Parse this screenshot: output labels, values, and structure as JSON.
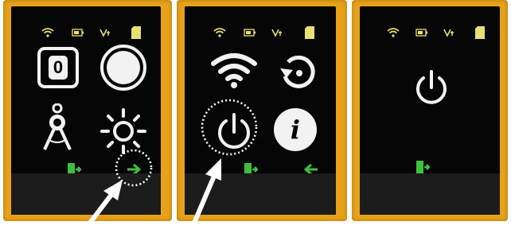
{
  "colors": {
    "housing": "#e8a21a",
    "screen": "#060606",
    "icon_white": "#f2f2f2",
    "nav_green": "#3fbf3f",
    "status_yellow": "#e8e070",
    "highlight_circle": "#ffffff"
  },
  "screens": [
    {
      "name": "main-menu",
      "status_icons": [
        "wifi-icon",
        "battery-icon",
        "bluetooth-icon",
        "sd-card-icon"
      ],
      "tiles": [
        {
          "icon": "counter-icon",
          "value": "0"
        },
        {
          "icon": "record-circle-icon"
        },
        {
          "icon": "compass-divider-icon"
        },
        {
          "icon": "brightness-icon"
        }
      ],
      "nav": [
        "exit-icon",
        "arrow-right-icon"
      ],
      "highlighted": "arrow-right-icon"
    },
    {
      "name": "settings-menu",
      "status_icons": [
        "wifi-icon",
        "battery-icon",
        "bluetooth-icon",
        "sd-card-icon"
      ],
      "tiles": [
        {
          "icon": "wifi-large-icon"
        },
        {
          "icon": "reset-icon"
        },
        {
          "icon": "power-icon"
        },
        {
          "icon": "info-icon",
          "value": "i"
        }
      ],
      "nav": [
        "exit-icon",
        "arrow-left-icon"
      ],
      "highlighted": "power-icon"
    },
    {
      "name": "power-screen",
      "status_icons": [
        "wifi-icon",
        "battery-icon",
        "bluetooth-icon",
        "sd-card-icon"
      ],
      "tiles": [
        {
          "icon": "power-icon"
        }
      ],
      "nav": [
        "exit-icon"
      ]
    }
  ]
}
